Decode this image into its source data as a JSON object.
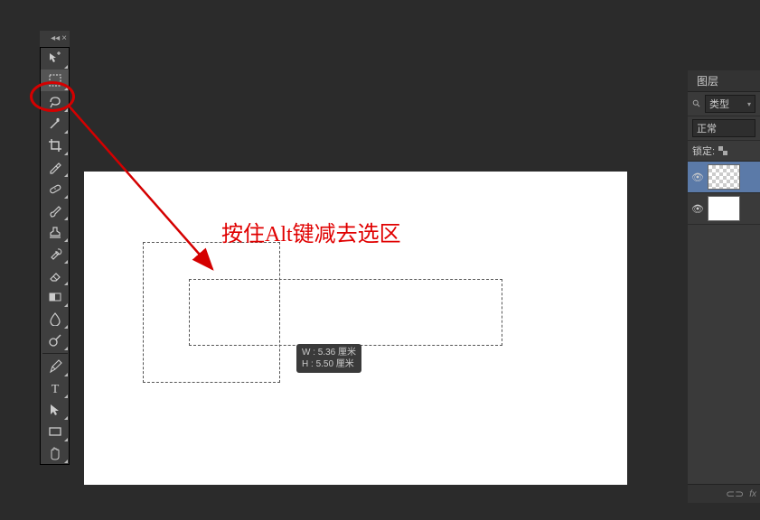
{
  "instruction_text": "按住Alt键减去选区",
  "measure": {
    "w_label": "W :",
    "w_value": "5.36 厘米",
    "h_label": "H :",
    "h_value": "5.50 厘米"
  },
  "layers_panel": {
    "tab_label": "图层",
    "filter_label": "类型",
    "blend_mode": "正常",
    "lock_label": "锁定:",
    "footer_fx": "fx",
    "layers": [
      {
        "visible": true,
        "checker": true
      },
      {
        "visible": true,
        "checker": false
      }
    ]
  },
  "tools": [
    {
      "name": "move-tool",
      "icon": "move"
    },
    {
      "name": "marquee-tool",
      "icon": "marquee",
      "selected": true
    },
    {
      "name": "lasso-tool",
      "icon": "lasso"
    },
    {
      "name": "magic-wand-tool",
      "icon": "wand"
    },
    {
      "name": "crop-tool",
      "icon": "crop"
    },
    {
      "name": "eyedropper-tool",
      "icon": "eyedropper"
    },
    {
      "name": "healing-brush-tool",
      "icon": "bandaid"
    },
    {
      "name": "brush-tool",
      "icon": "brush"
    },
    {
      "name": "stamp-tool",
      "icon": "stamp"
    },
    {
      "name": "history-brush-tool",
      "icon": "history"
    },
    {
      "name": "eraser-tool",
      "icon": "eraser"
    },
    {
      "name": "gradient-tool",
      "icon": "gradient"
    },
    {
      "name": "blur-tool",
      "icon": "blur"
    },
    {
      "name": "dodge-tool",
      "icon": "dodge"
    },
    {
      "name": "pen-tool",
      "icon": "pen"
    },
    {
      "name": "type-tool",
      "icon": "type"
    },
    {
      "name": "path-select-tool",
      "icon": "pathselect"
    },
    {
      "name": "rectangle-tool",
      "icon": "rect"
    },
    {
      "name": "hand-tool",
      "icon": "hand"
    }
  ]
}
